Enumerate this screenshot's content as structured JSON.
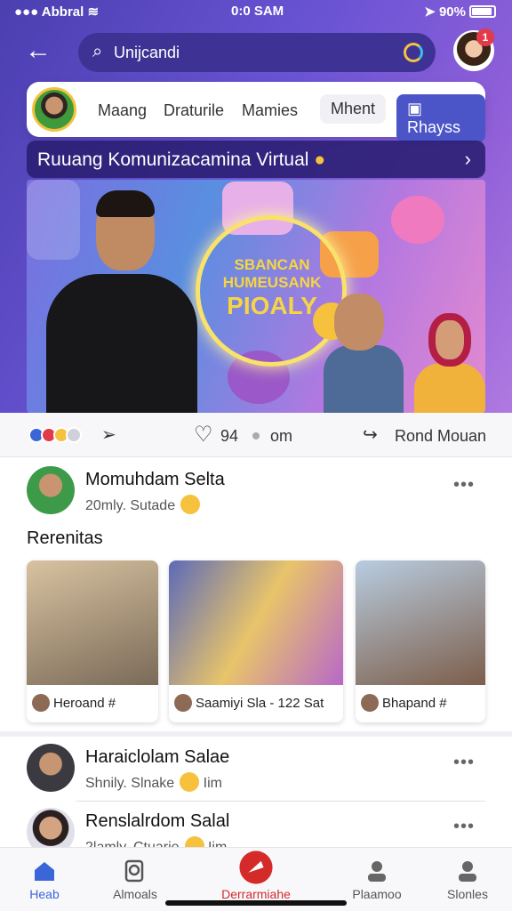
{
  "status": {
    "left": "Abbral",
    "time": "0:0 SAM",
    "battery": "90%"
  },
  "search": {
    "value": "Unijcandi"
  },
  "notifications": {
    "count": "1"
  },
  "tabs": [
    "Maang",
    "Draturile",
    "Mamies",
    "Mhent",
    "Rhayss"
  ],
  "banner": {
    "title": "Ruuang Komunizacamina Virtual"
  },
  "hero": {
    "line1": "SBANCAN",
    "line2": "HUMEUSANK",
    "line3": "PIOALY"
  },
  "actions": {
    "likes": "94",
    "comments": "om",
    "share_label": "Rond Mouan"
  },
  "post1": {
    "name": "Momuhdam Selta",
    "sub": "20mly. Sutade"
  },
  "section_title": "Rerenitas",
  "thumbs": [
    {
      "caption": "Heroand  #"
    },
    {
      "caption": "Saamiyi Sla - 122 Sat"
    },
    {
      "caption": "Bhapand  #"
    }
  ],
  "post2": {
    "name": "Haraiclolam Salae",
    "sub": "Shnily. Slnake",
    "tail": "Iim"
  },
  "post3": {
    "name": "Renslalrdom Salal",
    "sub": "2lamly. Ctuarie",
    "tail": "Iim"
  },
  "nav": [
    "Heab",
    "Almoals",
    "Derrarmiahe",
    "Plaamoo",
    "Slonles"
  ],
  "colors": {
    "accent": "#4b55c8",
    "special": "#d42a2a",
    "home": "#3a66d8"
  }
}
